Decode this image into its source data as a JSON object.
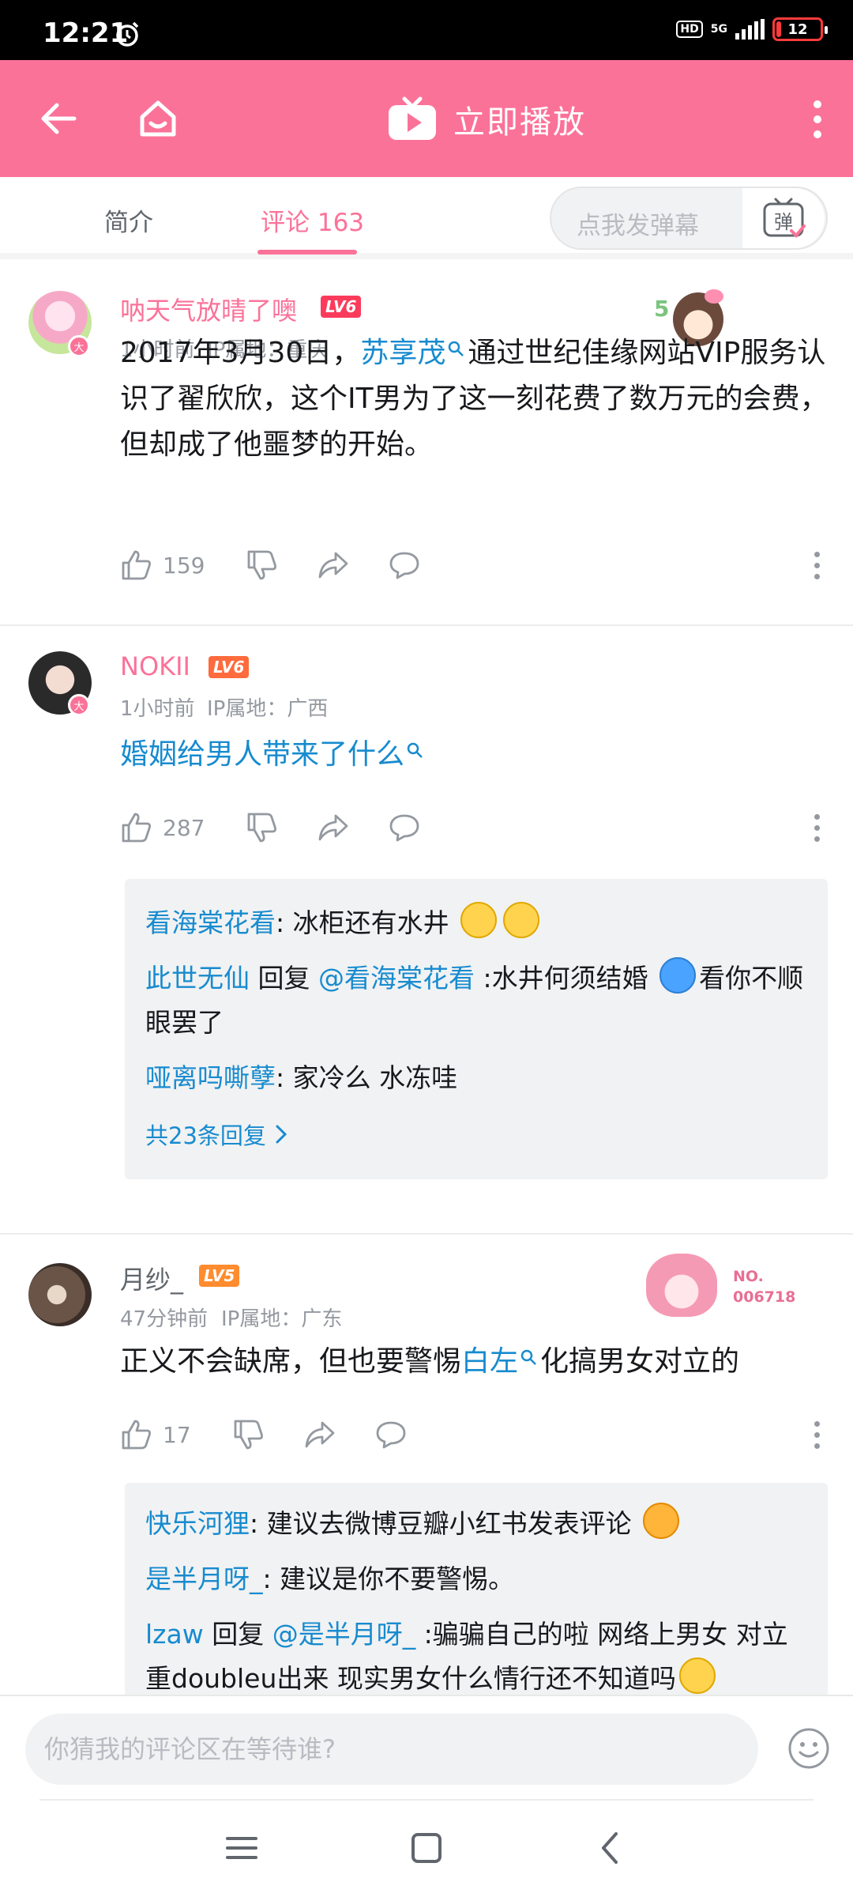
{
  "status_bar": {
    "time": "12:21",
    "hd": "HD",
    "network": "5G",
    "battery": "12",
    "battery_level": 0.12
  },
  "header": {
    "play_now_label": "立即播放"
  },
  "tabs": {
    "intro_label": "简介",
    "comments_label": "评论 163",
    "danmaku_placeholder": "点我发弹幕",
    "danmaku_icon_text": "弹"
  },
  "comments": [
    {
      "username": "呐天气放晴了噢",
      "level": "LV6",
      "avatar_badge": "大",
      "time": "1小时前",
      "ip": "IP属地：重庆",
      "text_before": "2017年3月30日，",
      "link": "苏享茂",
      "text_after": "通过世纪佳缘网站VIP服务认识了翟欣欣，这个IT男为了这一刻花费了数万元的会费，但却成了他噩梦的开始。",
      "likes": "159",
      "deco_number": "5"
    },
    {
      "username": "NOKII",
      "level": "LV6",
      "avatar_badge": "大",
      "time": "1小时前",
      "ip": "IP属地：广西",
      "link": "婚姻给男人带来了什么",
      "likes": "287",
      "replies": [
        {
          "user": "看海棠花看",
          "text": ": 冰柜还有水井"
        },
        {
          "user": "此世无仙",
          "reply_word": " 回复 ",
          "target": "@看海棠花看",
          "text_a": " :水井何须结婚",
          "text_b": "看你不顺眼罢了"
        },
        {
          "user": "哑离吗嘶孽",
          "text": ": 家冷么 水冻哇"
        }
      ],
      "more_replies": "共23条回复"
    },
    {
      "username": "月纱_",
      "level": "LV5",
      "time": "47分钟前",
      "ip": "IP属地：广东",
      "text_before": "正义不会缺席，但也要警惕",
      "link": "白左",
      "text_after": "化搞男女对立的",
      "likes": "17",
      "deco_no_label": "NO.",
      "deco_no_number": "006718",
      "replies": [
        {
          "user": "快乐河狸",
          "text": ": 建议去微博豆瓣小红书发表评论"
        },
        {
          "user": "是半月呀_",
          "text": ": 建议是你不要警惕。"
        },
        {
          "user": "lzaw",
          "reply_word": " 回复 ",
          "target": "@是半月呀_",
          "text_a": " :骗骗自己的啦 网络上男女",
          "text_b": "对立重doubleu出来 现实男女什么情行还不知道吗"
        }
      ]
    }
  ],
  "bottom": {
    "input_placeholder": "你猜我的评论区在等待谁?"
  }
}
